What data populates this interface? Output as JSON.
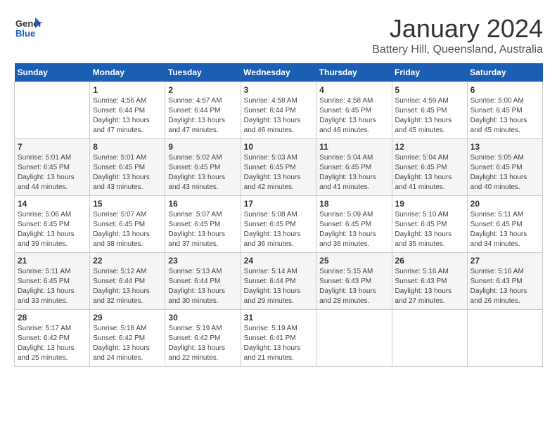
{
  "logo": {
    "text_general": "General",
    "text_blue": "Blue"
  },
  "header": {
    "month_year": "January 2024",
    "location": "Battery Hill, Queensland, Australia"
  },
  "weekdays": [
    "Sunday",
    "Monday",
    "Tuesday",
    "Wednesday",
    "Thursday",
    "Friday",
    "Saturday"
  ],
  "weeks": [
    [
      {
        "day": "",
        "sunrise": "",
        "sunset": "",
        "daylight": ""
      },
      {
        "day": "1",
        "sunrise": "Sunrise: 4:56 AM",
        "sunset": "Sunset: 6:44 PM",
        "daylight": "Daylight: 13 hours and 47 minutes."
      },
      {
        "day": "2",
        "sunrise": "Sunrise: 4:57 AM",
        "sunset": "Sunset: 6:44 PM",
        "daylight": "Daylight: 13 hours and 47 minutes."
      },
      {
        "day": "3",
        "sunrise": "Sunrise: 4:58 AM",
        "sunset": "Sunset: 6:44 PM",
        "daylight": "Daylight: 13 hours and 46 minutes."
      },
      {
        "day": "4",
        "sunrise": "Sunrise: 4:58 AM",
        "sunset": "Sunset: 6:45 PM",
        "daylight": "Daylight: 13 hours and 46 minutes."
      },
      {
        "day": "5",
        "sunrise": "Sunrise: 4:59 AM",
        "sunset": "Sunset: 6:45 PM",
        "daylight": "Daylight: 13 hours and 45 minutes."
      },
      {
        "day": "6",
        "sunrise": "Sunrise: 5:00 AM",
        "sunset": "Sunset: 6:45 PM",
        "daylight": "Daylight: 13 hours and 45 minutes."
      }
    ],
    [
      {
        "day": "7",
        "sunrise": "Sunrise: 5:01 AM",
        "sunset": "Sunset: 6:45 PM",
        "daylight": "Daylight: 13 hours and 44 minutes."
      },
      {
        "day": "8",
        "sunrise": "Sunrise: 5:01 AM",
        "sunset": "Sunset: 6:45 PM",
        "daylight": "Daylight: 13 hours and 43 minutes."
      },
      {
        "day": "9",
        "sunrise": "Sunrise: 5:02 AM",
        "sunset": "Sunset: 6:45 PM",
        "daylight": "Daylight: 13 hours and 43 minutes."
      },
      {
        "day": "10",
        "sunrise": "Sunrise: 5:03 AM",
        "sunset": "Sunset: 6:45 PM",
        "daylight": "Daylight: 13 hours and 42 minutes."
      },
      {
        "day": "11",
        "sunrise": "Sunrise: 5:04 AM",
        "sunset": "Sunset: 6:45 PM",
        "daylight": "Daylight: 13 hours and 41 minutes."
      },
      {
        "day": "12",
        "sunrise": "Sunrise: 5:04 AM",
        "sunset": "Sunset: 6:45 PM",
        "daylight": "Daylight: 13 hours and 41 minutes."
      },
      {
        "day": "13",
        "sunrise": "Sunrise: 5:05 AM",
        "sunset": "Sunset: 6:45 PM",
        "daylight": "Daylight: 13 hours and 40 minutes."
      }
    ],
    [
      {
        "day": "14",
        "sunrise": "Sunrise: 5:06 AM",
        "sunset": "Sunset: 6:45 PM",
        "daylight": "Daylight: 13 hours and 39 minutes."
      },
      {
        "day": "15",
        "sunrise": "Sunrise: 5:07 AM",
        "sunset": "Sunset: 6:45 PM",
        "daylight": "Daylight: 13 hours and 38 minutes."
      },
      {
        "day": "16",
        "sunrise": "Sunrise: 5:07 AM",
        "sunset": "Sunset: 6:45 PM",
        "daylight": "Daylight: 13 hours and 37 minutes."
      },
      {
        "day": "17",
        "sunrise": "Sunrise: 5:08 AM",
        "sunset": "Sunset: 6:45 PM",
        "daylight": "Daylight: 13 hours and 36 minutes."
      },
      {
        "day": "18",
        "sunrise": "Sunrise: 5:09 AM",
        "sunset": "Sunset: 6:45 PM",
        "daylight": "Daylight: 13 hours and 36 minutes."
      },
      {
        "day": "19",
        "sunrise": "Sunrise: 5:10 AM",
        "sunset": "Sunset: 6:45 PM",
        "daylight": "Daylight: 13 hours and 35 minutes."
      },
      {
        "day": "20",
        "sunrise": "Sunrise: 5:11 AM",
        "sunset": "Sunset: 6:45 PM",
        "daylight": "Daylight: 13 hours and 34 minutes."
      }
    ],
    [
      {
        "day": "21",
        "sunrise": "Sunrise: 5:11 AM",
        "sunset": "Sunset: 6:45 PM",
        "daylight": "Daylight: 13 hours and 33 minutes."
      },
      {
        "day": "22",
        "sunrise": "Sunrise: 5:12 AM",
        "sunset": "Sunset: 6:44 PM",
        "daylight": "Daylight: 13 hours and 32 minutes."
      },
      {
        "day": "23",
        "sunrise": "Sunrise: 5:13 AM",
        "sunset": "Sunset: 6:44 PM",
        "daylight": "Daylight: 13 hours and 30 minutes."
      },
      {
        "day": "24",
        "sunrise": "Sunrise: 5:14 AM",
        "sunset": "Sunset: 6:44 PM",
        "daylight": "Daylight: 13 hours and 29 minutes."
      },
      {
        "day": "25",
        "sunrise": "Sunrise: 5:15 AM",
        "sunset": "Sunset: 6:43 PM",
        "daylight": "Daylight: 13 hours and 28 minutes."
      },
      {
        "day": "26",
        "sunrise": "Sunrise: 5:16 AM",
        "sunset": "Sunset: 6:43 PM",
        "daylight": "Daylight: 13 hours and 27 minutes."
      },
      {
        "day": "27",
        "sunrise": "Sunrise: 5:16 AM",
        "sunset": "Sunset: 6:43 PM",
        "daylight": "Daylight: 13 hours and 26 minutes."
      }
    ],
    [
      {
        "day": "28",
        "sunrise": "Sunrise: 5:17 AM",
        "sunset": "Sunset: 6:42 PM",
        "daylight": "Daylight: 13 hours and 25 minutes."
      },
      {
        "day": "29",
        "sunrise": "Sunrise: 5:18 AM",
        "sunset": "Sunset: 6:42 PM",
        "daylight": "Daylight: 13 hours and 24 minutes."
      },
      {
        "day": "30",
        "sunrise": "Sunrise: 5:19 AM",
        "sunset": "Sunset: 6:42 PM",
        "daylight": "Daylight: 13 hours and 22 minutes."
      },
      {
        "day": "31",
        "sunrise": "Sunrise: 5:19 AM",
        "sunset": "Sunset: 6:41 PM",
        "daylight": "Daylight: 13 hours and 21 minutes."
      },
      {
        "day": "",
        "sunrise": "",
        "sunset": "",
        "daylight": ""
      },
      {
        "day": "",
        "sunrise": "",
        "sunset": "",
        "daylight": ""
      },
      {
        "day": "",
        "sunrise": "",
        "sunset": "",
        "daylight": ""
      }
    ]
  ]
}
